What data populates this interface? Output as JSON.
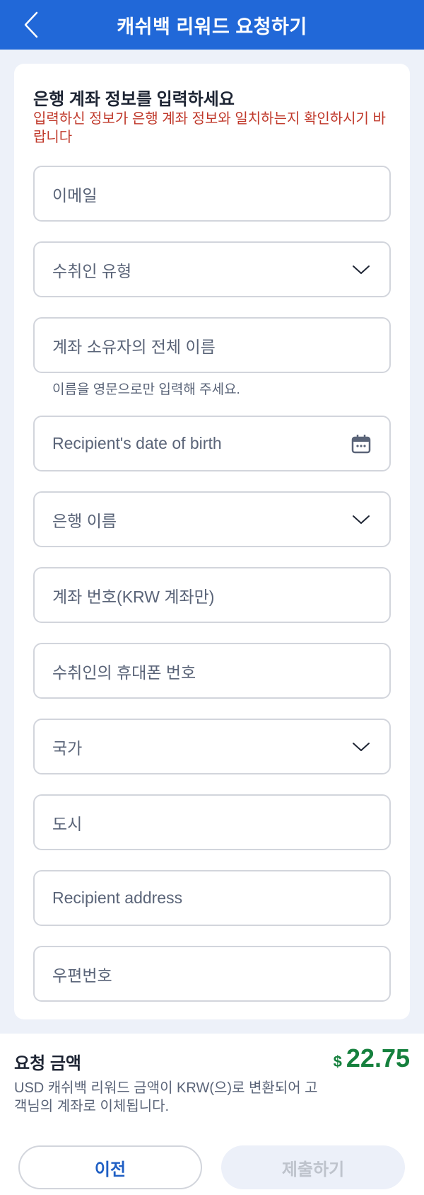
{
  "header": {
    "title": "캐쉬백 리워드 요청하기",
    "back_icon": "chevron-left-icon"
  },
  "form": {
    "title": "은행 계좌 정보를 입력하세요",
    "warning": "입력하신 정보가 은행 계좌 정보와 일치하는지 확인하시기 바랍니다",
    "fields": [
      {
        "placeholder": "이메일",
        "type": "text"
      },
      {
        "placeholder": "수취인 유형",
        "type": "select",
        "icon": "chevron-down-icon"
      },
      {
        "placeholder": "계좌 소유자의 전체 이름",
        "type": "text",
        "helper": "이름을 영문으로만 입력해 주세요."
      },
      {
        "placeholder": "Recipient's date of birth",
        "type": "date",
        "icon": "calendar-icon"
      },
      {
        "placeholder": "은행 이름",
        "type": "select",
        "icon": "chevron-down-icon"
      },
      {
        "placeholder": "계좌 번호(KRW 계좌만)",
        "type": "text"
      },
      {
        "placeholder": "수취인의 휴대폰 번호",
        "type": "text"
      },
      {
        "placeholder": "국가",
        "type": "select",
        "icon": "chevron-down-icon"
      },
      {
        "placeholder": "도시",
        "type": "text"
      },
      {
        "placeholder": "Recipient address",
        "type": "text"
      },
      {
        "placeholder": "우편번호",
        "type": "text"
      }
    ]
  },
  "summary": {
    "title": "요청 금액",
    "currency": "$",
    "amount": "22.75",
    "description": "USD 캐쉬백 리워드 금액이 KRW(으)로 변환되어 고객님의 계좌로 이체됩니다."
  },
  "buttons": {
    "prev_label": "이전",
    "submit_label": "제출하기",
    "submit_disabled": true
  },
  "colors": {
    "header_bg": "#2168d8",
    "warning": "#c0392b",
    "amount": "#15803d",
    "prev_text": "#1f5fc4",
    "submit_disabled_bg": "#ecf0f9"
  }
}
